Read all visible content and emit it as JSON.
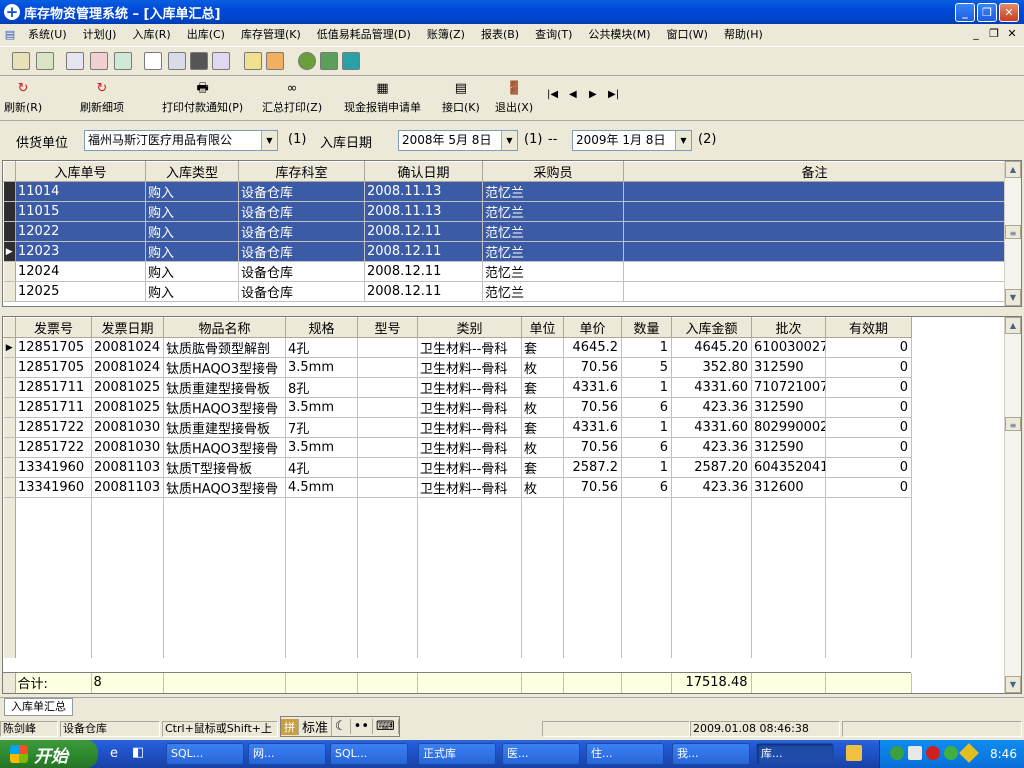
{
  "window": {
    "title": "库存物资管理系统 – [入库单汇总]"
  },
  "menu": [
    "系统(U)",
    "计划(J)",
    "入库(R)",
    "出库(C)",
    "库存管理(K)",
    "低值易耗品管理(D)",
    "账簿(Z)",
    "报表(B)",
    "查询(T)",
    "公共模块(M)",
    "窗口(W)",
    "帮助(H)"
  ],
  "toolbar2": {
    "refresh": "刷新(R)",
    "refresh_detail": "刷新细项",
    "print_payment": "打印付款通知(P)",
    "summary_print": "汇总打印(Z)",
    "cash_reimburse": "现金报销申请单",
    "interface": "接口(K)",
    "exit": "退出(X)"
  },
  "filter": {
    "supplier_label": "供货单位",
    "supplier_value": "福州马斯汀医疗用品有限公",
    "marker1": "(1)",
    "date_label": "入库日期",
    "date_from": "2008年 5月 8日",
    "marker_from": "(1)",
    "dash": "--",
    "date_to": "2009年 1月 8日",
    "marker_to": "(2)"
  },
  "upper_grid": {
    "columns": [
      "入库单号",
      "入库类型",
      "库存科室",
      "确认日期",
      "采购员",
      "备注"
    ],
    "rows": [
      {
        "id": "11014",
        "type": "购入",
        "dept": "设备仓库",
        "date": "2008.11.13",
        "buyer": "范忆兰",
        "note": "",
        "selected": true
      },
      {
        "id": "11015",
        "type": "购入",
        "dept": "设备仓库",
        "date": "2008.11.13",
        "buyer": "范忆兰",
        "note": "",
        "selected": true
      },
      {
        "id": "12022",
        "type": "购入",
        "dept": "设备仓库",
        "date": "2008.12.11",
        "buyer": "范忆兰",
        "note": "",
        "selected": true
      },
      {
        "id": "12023",
        "type": "购入",
        "dept": "设备仓库",
        "date": "2008.12.11",
        "buyer": "范忆兰",
        "note": "",
        "selected": true,
        "current": true
      },
      {
        "id": "12024",
        "type": "购入",
        "dept": "设备仓库",
        "date": "2008.12.11",
        "buyer": "范忆兰",
        "note": "",
        "selected": false
      },
      {
        "id": "12025",
        "type": "购入",
        "dept": "设备仓库",
        "date": "2008.12.11",
        "buyer": "范忆兰",
        "note": "",
        "selected": false
      }
    ]
  },
  "lower_grid": {
    "columns": [
      "发票号",
      "发票日期",
      "物品名称",
      "规格",
      "型号",
      "类别",
      "单位",
      "单价",
      "数量",
      "入库金额",
      "批次",
      "有效期"
    ],
    "rows": [
      {
        "inv": "12851705",
        "date": "20081024",
        "name": "钛质肱骨颈型解剖",
        "spec": "4孔",
        "model": "",
        "cat": "卫生材料--骨科",
        "unit": "套",
        "price": "4645.2",
        "qty": "1",
        "amount": "4645.20",
        "batch": "610030027",
        "expiry": "0"
      },
      {
        "inv": "12851705",
        "date": "20081024",
        "name": "钛质HAQO3型接骨",
        "spec": "3.5mm",
        "model": "",
        "cat": "卫生材料--骨科",
        "unit": "枚",
        "price": "70.56",
        "qty": "5",
        "amount": "352.80",
        "batch": "312590",
        "expiry": "0"
      },
      {
        "inv": "12851711",
        "date": "20081025",
        "name": "钛质重建型接骨板",
        "spec": "8孔",
        "model": "",
        "cat": "卫生材料--骨科",
        "unit": "套",
        "price": "4331.6",
        "qty": "1",
        "amount": "4331.60",
        "batch": "710721007",
        "expiry": "0"
      },
      {
        "inv": "12851711",
        "date": "20081025",
        "name": "钛质HAQO3型接骨",
        "spec": "3.5mm",
        "model": "",
        "cat": "卫生材料--骨科",
        "unit": "枚",
        "price": "70.56",
        "qty": "6",
        "amount": "423.36",
        "batch": "312590",
        "expiry": "0"
      },
      {
        "inv": "12851722",
        "date": "20081030",
        "name": "钛质重建型接骨板",
        "spec": "7孔",
        "model": "",
        "cat": "卫生材料--骨科",
        "unit": "套",
        "price": "4331.6",
        "qty": "1",
        "amount": "4331.60",
        "batch": "802990002",
        "expiry": "0"
      },
      {
        "inv": "12851722",
        "date": "20081030",
        "name": "钛质HAQO3型接骨",
        "spec": "3.5mm",
        "model": "",
        "cat": "卫生材料--骨科",
        "unit": "枚",
        "price": "70.56",
        "qty": "6",
        "amount": "423.36",
        "batch": "312590",
        "expiry": "0"
      },
      {
        "inv": "13341960",
        "date": "20081103",
        "name": "钛质T型接骨板",
        "spec": "4孔",
        "model": "",
        "cat": "卫生材料--骨科",
        "unit": "套",
        "price": "2587.2",
        "qty": "1",
        "amount": "2587.20",
        "batch": "604352041",
        "expiry": "0"
      },
      {
        "inv": "13341960",
        "date": "20081103",
        "name": "钛质HAQO3型接骨",
        "spec": "4.5mm",
        "model": "",
        "cat": "卫生材料--骨科",
        "unit": "枚",
        "price": "70.56",
        "qty": "6",
        "amount": "423.36",
        "batch": "312600",
        "expiry": "0"
      }
    ],
    "summary": {
      "label": "合计:",
      "count": "8",
      "total": "17518.48"
    }
  },
  "tab": "入库单汇总",
  "status": {
    "user": "陈剑峰",
    "dept": "设备仓库",
    "hint": "Ctrl+鼠标或Shift+上",
    "datetime": "2009.01.08 08:46:38"
  },
  "ime": {
    "mode": "标准"
  },
  "taskbar": {
    "start": "开始",
    "tasks": [
      "SQL...",
      "网...",
      "SQL...",
      "正式库",
      "医...",
      "住...",
      "我...",
      "库..."
    ],
    "time": "8:46"
  }
}
